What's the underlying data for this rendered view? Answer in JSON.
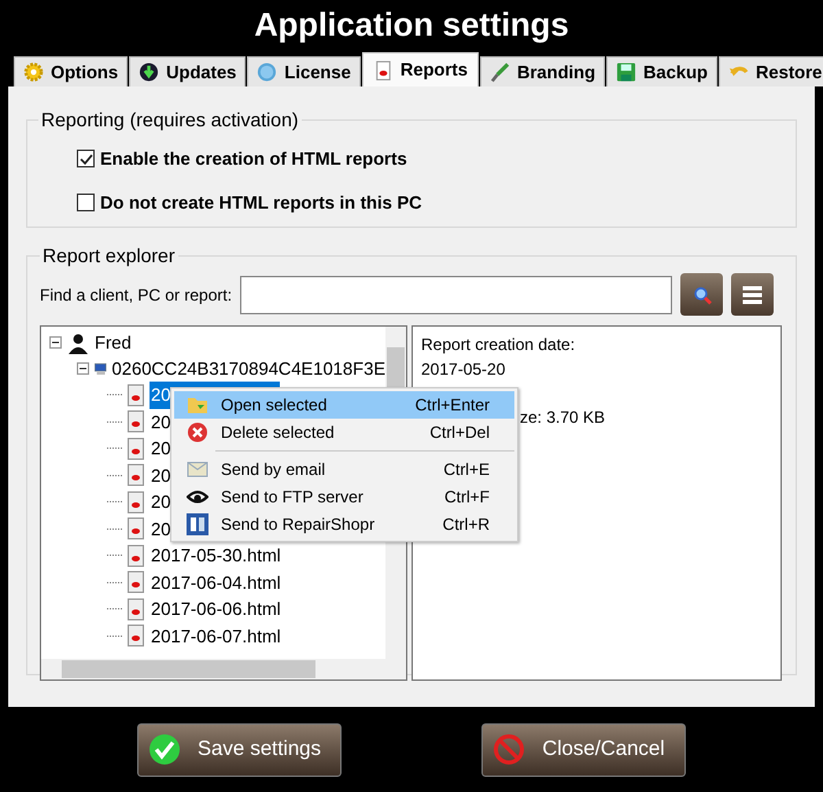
{
  "title": "Application settings",
  "tabs": [
    {
      "label": "Options",
      "selected": false
    },
    {
      "label": "Updates",
      "selected": false
    },
    {
      "label": "License",
      "selected": false
    },
    {
      "label": "Reports",
      "selected": true
    },
    {
      "label": "Branding",
      "selected": false
    },
    {
      "label": "Backup",
      "selected": false
    },
    {
      "label": "Restore",
      "selected": false
    }
  ],
  "reporting": {
    "title": "Reporting (requires activation)",
    "options": [
      {
        "label": "Enable the creation of HTML reports",
        "checked": true
      },
      {
        "label": "Do not create HTML reports in this PC",
        "checked": false
      }
    ]
  },
  "explorer": {
    "title": "Report explorer",
    "search": {
      "label": "Find a client, PC or report:"
    },
    "tree": [
      {
        "label": "Fred",
        "kind": "client",
        "expanded": true,
        "children": [
          {
            "label": "0260CC24B3170894C4E1018F3E",
            "kind": "pc",
            "expanded": true,
            "children": [
              {
                "label": "20",
                "kind": "report",
                "selected": true
              },
              {
                "label": "20",
                "kind": "report",
                "selected": false
              },
              {
                "label": "20",
                "kind": "report",
                "selected": false
              },
              {
                "label": "20",
                "kind": "report",
                "selected": false
              },
              {
                "label": "20",
                "kind": "report",
                "selected": false
              },
              {
                "label": "20",
                "kind": "report",
                "selected": false
              },
              {
                "label": "2017-05-30.html",
                "kind": "report",
                "selected": false
              },
              {
                "label": "2017-06-04.html",
                "kind": "report",
                "selected": false
              },
              {
                "label": "2017-06-06.html",
                "kind": "report",
                "selected": false
              },
              {
                "label": "2017-06-07.html",
                "kind": "report",
                "selected": false
              }
            ]
          }
        ]
      }
    ],
    "details": [
      "Report creation date:",
      "2017-05-20",
      "ze: 3.70 KB"
    ],
    "context_menu": [
      {
        "kind": "item",
        "label": "Open selected",
        "shortcut": "Ctrl+Enter",
        "selected": true
      },
      {
        "kind": "item",
        "label": "Delete selected",
        "shortcut": "Ctrl+Del",
        "selected": false
      },
      {
        "kind": "separator"
      },
      {
        "kind": "item",
        "label": "Send by email",
        "shortcut": "Ctrl+E",
        "selected": false
      },
      {
        "kind": "item",
        "label": "Send to FTP server",
        "shortcut": "Ctrl+F",
        "selected": false
      },
      {
        "kind": "item",
        "label": "Send to RepairShopr",
        "shortcut": "Ctrl+R",
        "selected": false
      }
    ]
  },
  "buttons": [
    {
      "label": "Save settings",
      "kind": "save"
    },
    {
      "label": "Close/Cancel",
      "kind": "cancel"
    }
  ]
}
